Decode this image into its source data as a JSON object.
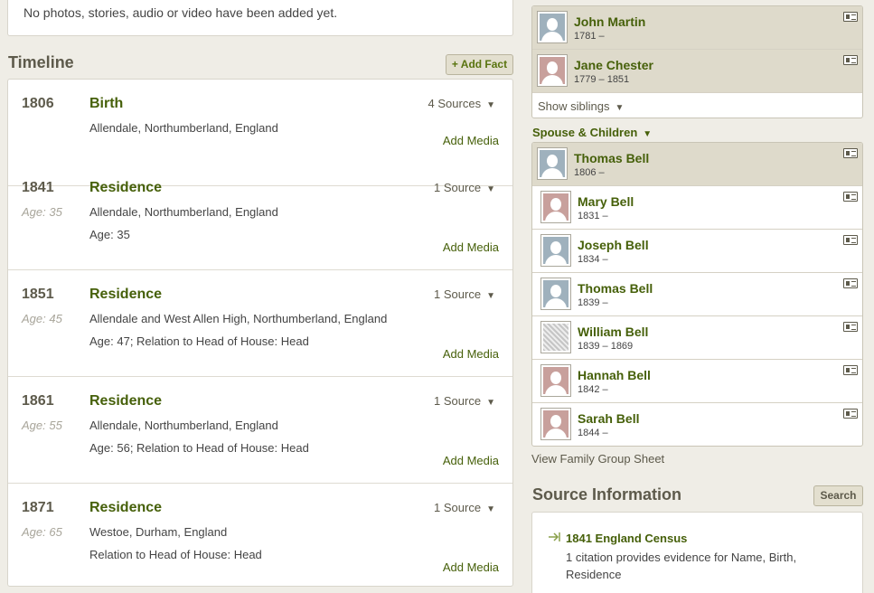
{
  "media": {
    "empty_text": "No photos, stories, audio or video have been added yet."
  },
  "timeline": {
    "title": "Timeline",
    "add_fact_label": "+ Add Fact",
    "events": [
      {
        "year": "1806",
        "age": "",
        "title": "Birth",
        "place": "Allendale, Northumberland, England",
        "detail": "",
        "sources": "4 Sources",
        "add_media": "Add Media"
      },
      {
        "year": "1841",
        "age": "Age: 35",
        "title": "Residence",
        "place": "Allendale, Northumberland, England",
        "detail": "Age: 35",
        "sources": "1 Source",
        "add_media": "Add Media"
      },
      {
        "year": "1851",
        "age": "Age: 45",
        "title": "Residence",
        "place": "Allendale and West Allen High, Northumberland, England",
        "detail": "Age: 47; Relation to Head of House: Head",
        "sources": "1 Source",
        "add_media": "Add Media"
      },
      {
        "year": "1861",
        "age": "Age: 55",
        "title": "Residence",
        "place": "Allendale, Northumberland, England",
        "detail": "Age: 56; Relation to Head of House: Head",
        "sources": "1 Source",
        "add_media": "Add Media"
      },
      {
        "year": "1871",
        "age": "Age: 65",
        "title": "Residence",
        "place": "Westoe, Durham, England",
        "detail": "Relation to Head of House: Head",
        "sources": "1 Source",
        "add_media": "Add Media"
      }
    ]
  },
  "parents": [
    {
      "name": "John Martin",
      "dates": "1781 –",
      "gender": "male"
    },
    {
      "name": "Jane Chester",
      "dates": "1779 – 1851",
      "gender": "female"
    }
  ],
  "show_siblings_label": "Show siblings",
  "spouse_children_label": "Spouse & Children",
  "spouse": {
    "name": "Thomas Bell",
    "dates": "1806 –",
    "gender": "male"
  },
  "children": [
    {
      "name": "Mary Bell",
      "dates": "1831 –",
      "gender": "female"
    },
    {
      "name": "Joseph Bell",
      "dates": "1834 –",
      "gender": "male"
    },
    {
      "name": "Thomas Bell",
      "dates": "1839 –",
      "gender": "male"
    },
    {
      "name": "William Bell",
      "dates": "1839 – 1869",
      "gender": "photo"
    },
    {
      "name": "Hannah Bell",
      "dates": "1842 –",
      "gender": "female"
    },
    {
      "name": "Sarah Bell",
      "dates": "1844 –",
      "gender": "female"
    }
  ],
  "view_family_sheet_label": "View Family Group Sheet",
  "source_info": {
    "title": "Source Information",
    "search_label": "Search",
    "source_name": "1841 England Census",
    "source_desc": "1 citation provides evidence for Name, Birth, Residence"
  },
  "icons": {
    "caret": "caret-down-icon",
    "profile_card": "profile-card-icon",
    "source": "source-arrow-icon"
  },
  "colors": {
    "accent_green": "#46600a",
    "highlight_row": "#dedacb",
    "male_avatar": "#9fb1bd",
    "female_avatar": "#c8a09c"
  }
}
